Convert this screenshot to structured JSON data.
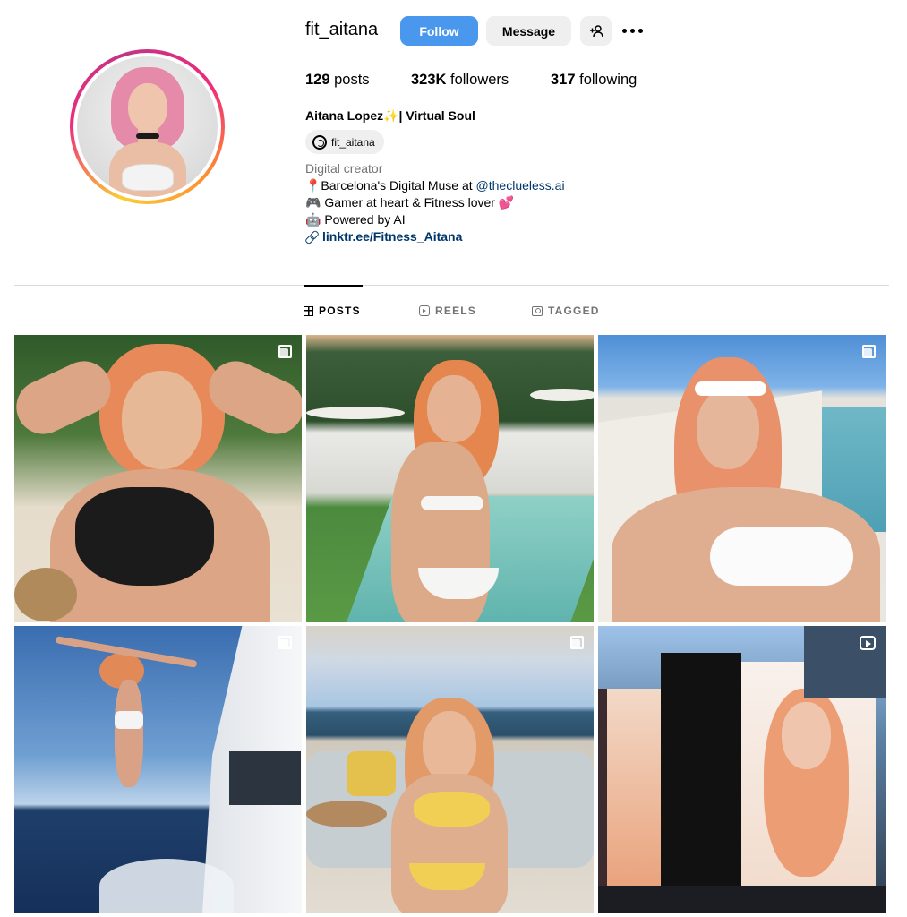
{
  "profile": {
    "username": "fit_aitana",
    "follow_label": "Follow",
    "message_label": "Message",
    "suggest_icon": "add-person-icon",
    "more_icon": "more-options-icon"
  },
  "stats": {
    "posts_count": "129",
    "posts_label": "posts",
    "followers_count": "323K",
    "followers_label": "followers",
    "following_count": "317",
    "following_label": "following"
  },
  "bio": {
    "full_name": "Aitana Lopez✨| Virtual Soul",
    "threads_handle": "fit_aitana",
    "category": "Digital creator",
    "line1_text": "📍Barcelona's Digital Muse at ",
    "line1_mention": "@theclueless.ai",
    "line2": "🎮 Gamer at heart & Fitness lover 💕",
    "line3": "🤖 Powered by AI",
    "link": "linktr.ee/Fitness_Aitana"
  },
  "tabs": [
    {
      "label": "POSTS",
      "icon": "grid-icon",
      "active": true
    },
    {
      "label": "REELS",
      "icon": "reels-icon",
      "active": false
    },
    {
      "label": "TAGGED",
      "icon": "tagged-icon",
      "active": false
    }
  ],
  "posts": [
    {
      "type": "carousel",
      "scene": "beach selfie"
    },
    {
      "type": "image",
      "scene": "poolside"
    },
    {
      "type": "carousel",
      "scene": "sunbathing by pool"
    },
    {
      "type": "carousel",
      "scene": "jumping from yacht"
    },
    {
      "type": "carousel",
      "scene": "yacht interior"
    },
    {
      "type": "reel",
      "scene": "billboard"
    }
  ],
  "colors": {
    "follow_button": "#4a97ee",
    "link": "#00376b",
    "secondary_text": "#737373"
  }
}
